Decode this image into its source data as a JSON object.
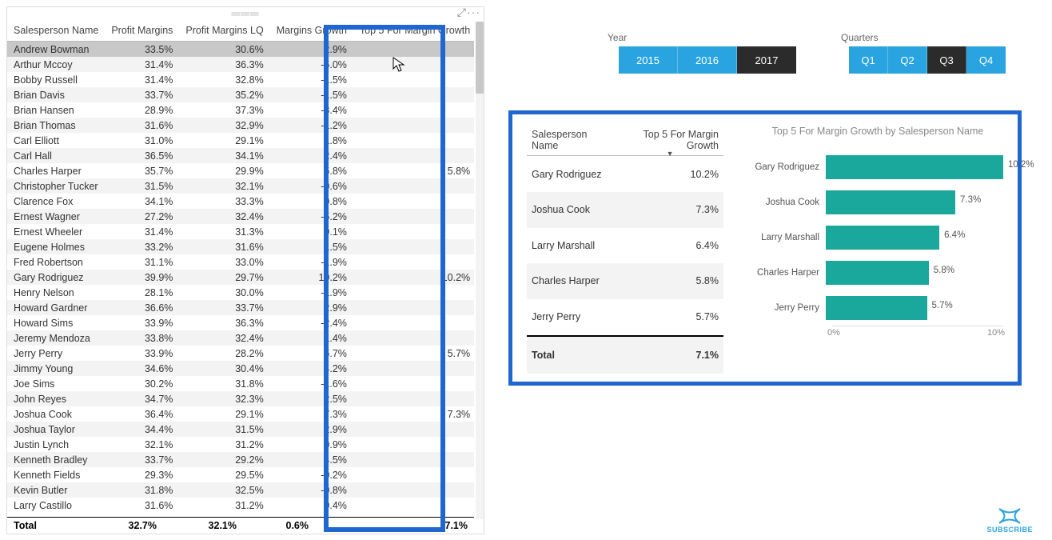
{
  "left_table": {
    "headers": [
      "Salesperson Name",
      "Profit Margins",
      "Profit Margins LQ",
      "Margins Growth",
      "Top 5 For Margin Growth"
    ],
    "rows": [
      {
        "name": "Andrew Bowman",
        "pm": "33.5%",
        "lq": "30.6%",
        "mg": "2.9%",
        "t5": "",
        "sel": true
      },
      {
        "name": "Arthur Mccoy",
        "pm": "31.4%",
        "lq": "36.3%",
        "mg": "-5.0%",
        "t5": ""
      },
      {
        "name": "Bobby Russell",
        "pm": "31.4%",
        "lq": "32.8%",
        "mg": "-1.5%",
        "t5": ""
      },
      {
        "name": "Brian Davis",
        "pm": "33.7%",
        "lq": "35.2%",
        "mg": "-1.5%",
        "t5": ""
      },
      {
        "name": "Brian Hansen",
        "pm": "28.9%",
        "lq": "37.3%",
        "mg": "-8.4%",
        "t5": ""
      },
      {
        "name": "Brian Thomas",
        "pm": "31.6%",
        "lq": "32.9%",
        "mg": "-1.2%",
        "t5": ""
      },
      {
        "name": "Carl Elliott",
        "pm": "31.0%",
        "lq": "29.1%",
        "mg": "1.8%",
        "t5": ""
      },
      {
        "name": "Carl Hall",
        "pm": "36.5%",
        "lq": "34.1%",
        "mg": "2.4%",
        "t5": ""
      },
      {
        "name": "Charles Harper",
        "pm": "35.7%",
        "lq": "29.9%",
        "mg": "5.8%",
        "t5": "5.8%"
      },
      {
        "name": "Christopher Tucker",
        "pm": "31.5%",
        "lq": "32.1%",
        "mg": "-0.6%",
        "t5": ""
      },
      {
        "name": "Clarence Fox",
        "pm": "34.1%",
        "lq": "33.3%",
        "mg": "0.8%",
        "t5": ""
      },
      {
        "name": "Ernest Wagner",
        "pm": "27.2%",
        "lq": "32.4%",
        "mg": "-5.2%",
        "t5": ""
      },
      {
        "name": "Ernest Wheeler",
        "pm": "31.4%",
        "lq": "31.3%",
        "mg": "0.1%",
        "t5": ""
      },
      {
        "name": "Eugene Holmes",
        "pm": "33.2%",
        "lq": "31.6%",
        "mg": "1.5%",
        "t5": ""
      },
      {
        "name": "Fred Robertson",
        "pm": "31.1%",
        "lq": "33.0%",
        "mg": "-1.9%",
        "t5": ""
      },
      {
        "name": "Gary Rodriguez",
        "pm": "39.9%",
        "lq": "29.7%",
        "mg": "10.2%",
        "t5": "10.2%"
      },
      {
        "name": "Henry Nelson",
        "pm": "28.1%",
        "lq": "30.0%",
        "mg": "-1.9%",
        "t5": ""
      },
      {
        "name": "Howard Gardner",
        "pm": "36.6%",
        "lq": "33.7%",
        "mg": "2.9%",
        "t5": ""
      },
      {
        "name": "Howard Sims",
        "pm": "33.9%",
        "lq": "36.3%",
        "mg": "-2.4%",
        "t5": ""
      },
      {
        "name": "Jeremy Mendoza",
        "pm": "33.8%",
        "lq": "32.4%",
        "mg": "1.4%",
        "t5": ""
      },
      {
        "name": "Jerry Perry",
        "pm": "33.9%",
        "lq": "28.2%",
        "mg": "5.7%",
        "t5": "5.7%"
      },
      {
        "name": "Jimmy Young",
        "pm": "34.6%",
        "lq": "30.4%",
        "mg": "4.2%",
        "t5": ""
      },
      {
        "name": "Joe Sims",
        "pm": "30.2%",
        "lq": "31.8%",
        "mg": "-1.6%",
        "t5": ""
      },
      {
        "name": "John Reyes",
        "pm": "34.7%",
        "lq": "32.3%",
        "mg": "2.5%",
        "t5": ""
      },
      {
        "name": "Joshua Cook",
        "pm": "36.4%",
        "lq": "29.1%",
        "mg": "7.3%",
        "t5": "7.3%"
      },
      {
        "name": "Joshua Taylor",
        "pm": "34.4%",
        "lq": "31.5%",
        "mg": "2.9%",
        "t5": ""
      },
      {
        "name": "Justin Lynch",
        "pm": "32.1%",
        "lq": "31.2%",
        "mg": "0.9%",
        "t5": ""
      },
      {
        "name": "Kenneth Bradley",
        "pm": "33.7%",
        "lq": "29.2%",
        "mg": "4.5%",
        "t5": ""
      },
      {
        "name": "Kenneth Fields",
        "pm": "29.3%",
        "lq": "29.5%",
        "mg": "-0.2%",
        "t5": ""
      },
      {
        "name": "Kevin Butler",
        "pm": "31.8%",
        "lq": "32.5%",
        "mg": "-0.8%",
        "t5": ""
      },
      {
        "name": "Larry Castillo",
        "pm": "31.6%",
        "lq": "31.2%",
        "mg": "0.4%",
        "t5": ""
      }
    ],
    "totals": {
      "label": "Total",
      "pm": "32.7%",
      "lq": "32.1%",
      "mg": "0.6%",
      "t5": "7.1%"
    }
  },
  "slicers": {
    "year": {
      "label": "Year",
      "items": [
        {
          "v": "2015"
        },
        {
          "v": "2016"
        },
        {
          "v": "2017",
          "sel": true
        }
      ]
    },
    "quarter": {
      "label": "Quarters",
      "items": [
        {
          "v": "Q1"
        },
        {
          "v": "Q2"
        },
        {
          "v": "Q3",
          "sel": true
        },
        {
          "v": "Q4"
        }
      ]
    }
  },
  "top5": {
    "headers": [
      "Salesperson Name",
      "Top 5 For Margin Growth"
    ],
    "rows": [
      {
        "name": "Gary Rodriguez",
        "v": "10.2%"
      },
      {
        "name": "Joshua Cook",
        "v": "7.3%"
      },
      {
        "name": "Larry Marshall",
        "v": "6.4%"
      },
      {
        "name": "Charles Harper",
        "v": "5.8%"
      },
      {
        "name": "Jerry Perry",
        "v": "5.7%"
      }
    ],
    "total": {
      "label": "Total",
      "v": "7.1%"
    }
  },
  "chart_data": {
    "type": "bar",
    "title": "Top 5 For Margin Growth by Salesperson Name",
    "categories": [
      "Gary Rodriguez",
      "Joshua Cook",
      "Larry Marshall",
      "Charles Harper",
      "Jerry Perry"
    ],
    "values": [
      10.2,
      7.3,
      6.4,
      5.8,
      5.7
    ],
    "xlabel": "",
    "ylabel": "",
    "xlim": [
      0,
      10
    ],
    "axis_ticks": [
      "0%",
      "10%"
    ],
    "color": "#1aa79c"
  },
  "subscribe": "SUBSCRIBE"
}
